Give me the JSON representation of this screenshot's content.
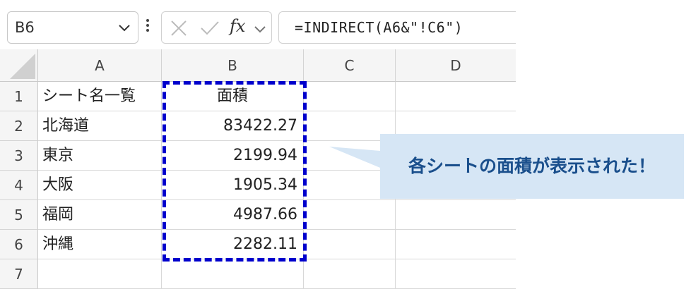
{
  "name_box": {
    "value": "B6"
  },
  "formula_bar": {
    "formula": "=INDIRECT(A6&\"!C6\")",
    "fx_label": "fx"
  },
  "columns": [
    "A",
    "B",
    "C",
    "D"
  ],
  "rows": [
    {
      "num": "1",
      "a": "シート名一覧",
      "b": "面積"
    },
    {
      "num": "2",
      "a": "北海道",
      "b": "83422.27"
    },
    {
      "num": "3",
      "a": "東京",
      "b": "2199.94"
    },
    {
      "num": "4",
      "a": "大阪",
      "b": "1905.34"
    },
    {
      "num": "5",
      "a": "福岡",
      "b": "4987.66"
    },
    {
      "num": "6",
      "a": "沖縄",
      "b": "2282.11"
    },
    {
      "num": "7",
      "a": "",
      "b": ""
    }
  ],
  "callout": {
    "text": "各シートの面積が表示された！",
    "fill": "#d6e6f5",
    "text_color": "#1a4f8c"
  },
  "selection_color": "#0000cc"
}
